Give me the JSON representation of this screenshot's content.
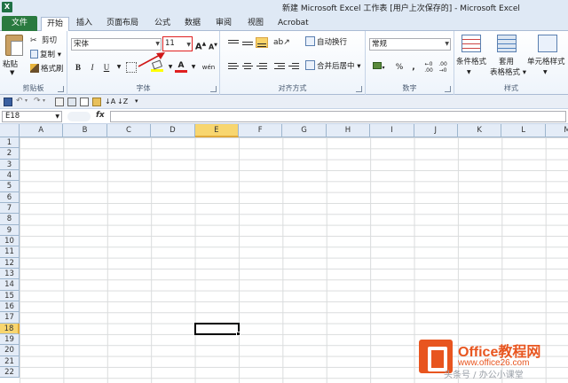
{
  "app": {
    "icon_glyph": "X",
    "title": "新建 Microsoft Excel 工作表 [用户上次保存的] - Microsoft Excel"
  },
  "tabs": [
    "文件",
    "开始",
    "插入",
    "页面布局",
    "公式",
    "数据",
    "审阅",
    "视图",
    "Acrobat"
  ],
  "active_tab": "开始",
  "ribbon": {
    "clipboard": {
      "paste": "粘贴",
      "cut": "剪切",
      "copy": "复制",
      "format_painter": "格式刷",
      "label": "剪贴板"
    },
    "font": {
      "font_name": "宋体",
      "font_size": "11",
      "grow": "A",
      "shrink": "A",
      "bold": "B",
      "italic": "I",
      "underline": "U",
      "font_color_glyph": "A",
      "wen": "wén",
      "label": "字体"
    },
    "alignment": {
      "wrap_text": "自动换行",
      "merge_center": "合并后居中",
      "label": "对齐方式"
    },
    "number": {
      "format": "常规",
      "currency": "$",
      "percent": "%",
      "comma": ",",
      "label": "数字"
    },
    "styles": {
      "conditional": "条件格式",
      "table_line1": "套用",
      "table_line2": "表格格式",
      "cell_styles": "单元格样式",
      "label": "样式"
    }
  },
  "formula_bar": {
    "name_box": "E18",
    "fx": "fx",
    "content": ""
  },
  "grid": {
    "columns": [
      "A",
      "B",
      "C",
      "D",
      "E",
      "F",
      "G",
      "H",
      "I",
      "J",
      "K",
      "L",
      "M"
    ],
    "rows": [
      "1",
      "2",
      "3",
      "4",
      "5",
      "6",
      "7",
      "8",
      "9",
      "10",
      "11",
      "12",
      "13",
      "14",
      "15",
      "16",
      "17",
      "18",
      "19",
      "20",
      "21",
      "22"
    ],
    "selected_column": "E",
    "selected_row": "18"
  },
  "watermark": {
    "name": "Office教程网",
    "url": "www.office26.com",
    "sub": "头条号 / 办公小课堂"
  },
  "colors": {
    "file_tab": "#2a7a3f",
    "selection_header": "#f8d66f",
    "highlight_box": "#e02020",
    "watermark": "#e8551f"
  }
}
